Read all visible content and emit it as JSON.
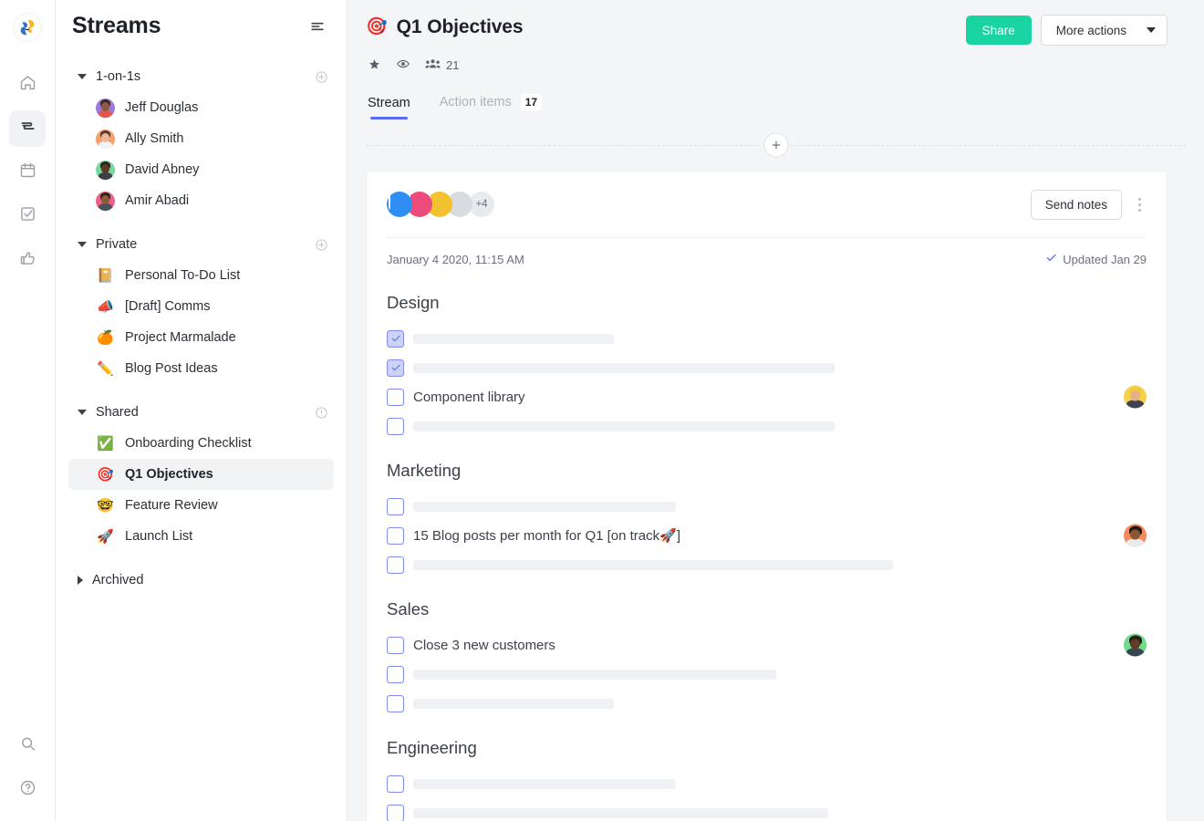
{
  "rail": {
    "logo_name": "app-logo",
    "items": [
      {
        "name": "home",
        "icon": "home-icon",
        "active": false
      },
      {
        "name": "streams",
        "icon": "streams-icon",
        "active": true
      },
      {
        "name": "calendar",
        "icon": "calendar-icon",
        "active": false
      },
      {
        "name": "tasks",
        "icon": "checkbox-icon",
        "active": false
      },
      {
        "name": "praise",
        "icon": "thumbs-up-icon",
        "active": false
      }
    ],
    "bottom": [
      {
        "name": "search",
        "icon": "search-icon"
      },
      {
        "name": "help",
        "icon": "help-circle-icon"
      }
    ]
  },
  "sidebar": {
    "title": "Streams",
    "menu_icon": "hamburger-icon",
    "groups": [
      {
        "label": "1-on-1s",
        "expanded": true,
        "action_icon": "plus-circle-icon",
        "items": [
          {
            "label": "Jeff Douglas",
            "type": "avatar",
            "bg": "#9b7ae0",
            "skin": "#8d5a3f",
            "hair": "#3a2b26",
            "body": "#e2574c"
          },
          {
            "label": "Ally Smith",
            "type": "avatar",
            "bg": "#f8a06a",
            "skin": "#e7b99a",
            "hair": "#5b3a2a",
            "body": "#f2f3f5"
          },
          {
            "label": "David Abney",
            "type": "avatar",
            "bg": "#74d99f",
            "skin": "#5a3b28",
            "hair": "#2e221c",
            "body": "#3c4049"
          },
          {
            "label": "Amir Abadi",
            "type": "avatar",
            "bg": "#ef5f8b",
            "skin": "#8a5a3c",
            "hair": "#2b2119",
            "body": "#4a5260"
          }
        ]
      },
      {
        "label": "Private",
        "expanded": true,
        "action_icon": "plus-circle-icon",
        "items": [
          {
            "label": "Personal To-Do List",
            "type": "emoji",
            "emoji": "📔"
          },
          {
            "label": "[Draft] Comms",
            "type": "emoji",
            "emoji": "📣"
          },
          {
            "label": "Project Marmalade",
            "type": "emoji",
            "emoji": "🍊"
          },
          {
            "label": "Blog Post Ideas",
            "type": "emoji",
            "emoji": "✏️"
          }
        ]
      },
      {
        "label": "Shared",
        "expanded": true,
        "action_icon": "info-circle-icon",
        "items": [
          {
            "label": "Onboarding Checklist",
            "type": "emoji",
            "emoji": "✅"
          },
          {
            "label": "Q1 Objectives",
            "type": "emoji",
            "emoji": "🎯",
            "selected": true
          },
          {
            "label": "Feature Review",
            "type": "emoji",
            "emoji": "🤓"
          },
          {
            "label": "Launch List",
            "type": "emoji",
            "emoji": "🚀"
          }
        ]
      },
      {
        "label": "Archived",
        "expanded": false,
        "action_icon": null,
        "items": []
      }
    ]
  },
  "header": {
    "doc_emoji": "🎯",
    "title": "Q1 Objectives",
    "share_label": "Share",
    "more_actions_label": "More actions",
    "star_icon": "star-icon",
    "watch_icon": "eye-icon",
    "members_icon": "people-icon",
    "members_count": "21",
    "tabs": [
      {
        "label": "Stream",
        "active": true,
        "badge": null
      },
      {
        "label": "Action items",
        "active": false,
        "badge": "17"
      }
    ],
    "add_icon": "plus-icon"
  },
  "card": {
    "avatars": [
      {
        "ring": "#2f8ef4",
        "bg": "#ffffff",
        "skin": "#8d5a3f",
        "hair": "#2b1d18",
        "body": "#f0d6c8"
      },
      {
        "ring": "#ec4b7b",
        "bg": "#ffffff",
        "skin": "#e2b48f",
        "hair": "#f2d24b",
        "body": "#f5cf3d"
      },
      {
        "ring": "#f2c230",
        "bg": "#7ee08f",
        "skin": "#6b452d",
        "hair": "#241a14",
        "body": "#3a4350"
      },
      {
        "ring": "#d9dbe0",
        "bg": "#d9dbe0",
        "skin": "#b9bcc4",
        "hair": "#9ba0ab",
        "body": "#c9ccd3"
      }
    ],
    "avatar_overflow": "+4",
    "send_notes_label": "Send notes",
    "kebab_icon": "kebab-menu-icon",
    "timestamp": "January 4 2020, 11:15 AM",
    "updated_label": "Updated Jan 29",
    "updated_icon": "check-icon",
    "sections": [
      {
        "title": "Design",
        "tasks": [
          {
            "checked": true,
            "text": null,
            "redact_width": 220,
            "avatar": null
          },
          {
            "checked": true,
            "text": null,
            "redact_width": 462,
            "avatar": null
          },
          {
            "checked": false,
            "text": "Component library",
            "redact_width": 0,
            "avatar": {
              "bg": "#f5d14e",
              "skin": "#e3b08a",
              "hair": "#f0c93c",
              "body": "#3b4452"
            }
          },
          {
            "checked": false,
            "text": null,
            "redact_width": 462,
            "avatar": null
          }
        ]
      },
      {
        "title": "Marketing",
        "tasks": [
          {
            "checked": false,
            "text": null,
            "redact_width": 288,
            "avatar": null
          },
          {
            "checked": false,
            "text": "15 Blog posts per month for Q1 [on track🚀]",
            "redact_width": 0,
            "avatar": {
              "bg": "#f58a5e",
              "skin": "#8a5634",
              "hair": "#241812",
              "body": "#e9ecef"
            }
          },
          {
            "checked": false,
            "text": null,
            "redact_width": 526,
            "avatar": null
          }
        ]
      },
      {
        "title": "Sales",
        "tasks": [
          {
            "checked": false,
            "text": "Close 3 new customers",
            "redact_width": 0,
            "avatar": {
              "bg": "#6fdc8c",
              "skin": "#5e3c26",
              "hair": "#2a1d15",
              "body": "#3b4452"
            }
          },
          {
            "checked": false,
            "text": null,
            "redact_width": 398,
            "avatar": null
          },
          {
            "checked": false,
            "text": null,
            "redact_width": 220,
            "avatar": null
          }
        ]
      },
      {
        "title": "Engineering",
        "tasks": [
          {
            "checked": false,
            "text": null,
            "redact_width": 288,
            "avatar": null
          },
          {
            "checked": false,
            "text": null,
            "redact_width": 455,
            "avatar": null
          }
        ]
      }
    ]
  },
  "colors": {
    "accent_teal": "#19d3a2",
    "accent_blue": "#5b6bef",
    "checkbox_border": "#7f8ced",
    "checkbox_fill": "#ccd2f8"
  }
}
